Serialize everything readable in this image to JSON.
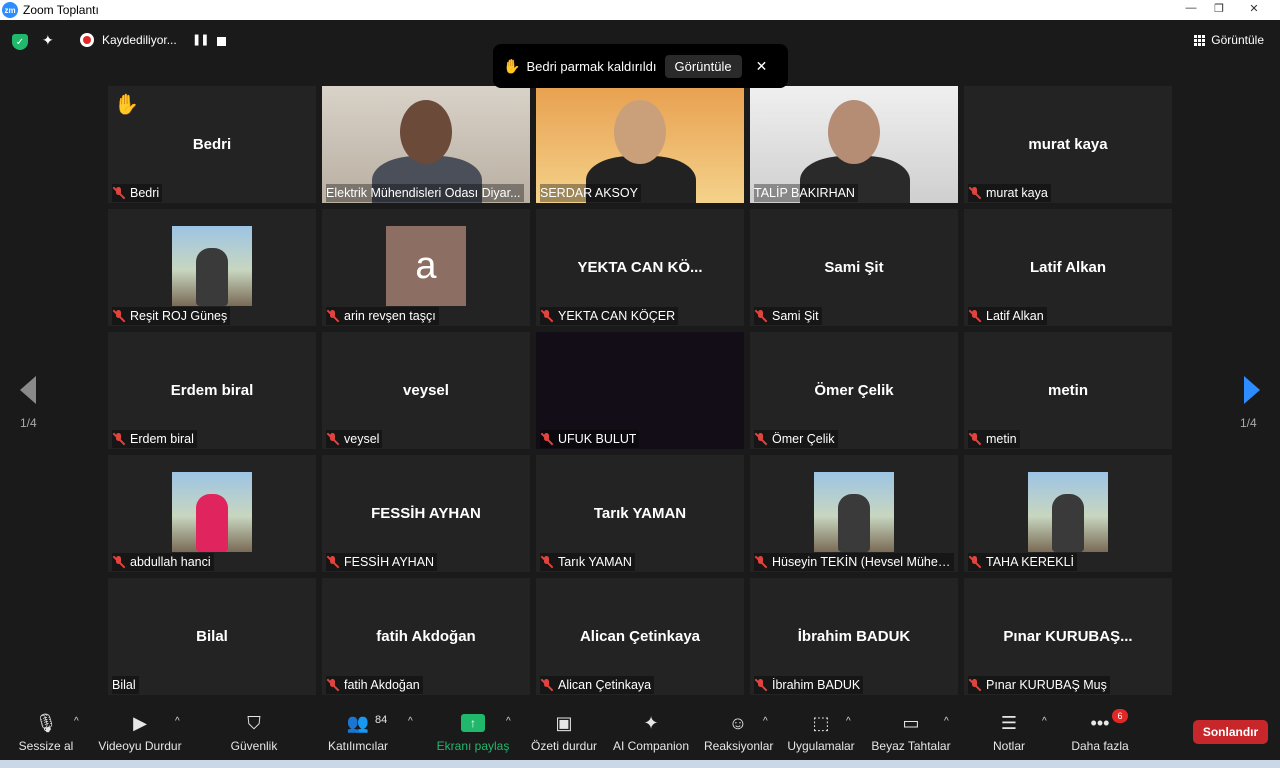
{
  "window": {
    "app_icon": "zm",
    "title": "Zoom Toplantı",
    "minimize": "—",
    "restore": "❐",
    "close": "✕"
  },
  "topbar": {
    "security_icon": "shield-check-icon",
    "ai_icon": "sparkle-icon",
    "recording_label": "Kaydediliyor...",
    "pause_symbol": "❚❚",
    "view_label": "Görüntüle"
  },
  "toast": {
    "hand": "✋",
    "message": "Bedri parmak kaldırıldı",
    "view_label": "Görüntüle",
    "close": "✕"
  },
  "pagination": {
    "left": "1/4",
    "right": "1/4"
  },
  "participants": [
    {
      "name": "Bedri",
      "center": "Bedri",
      "type": "name",
      "hand_raised": true,
      "muted": true
    },
    {
      "name": "Elektrik Mühendisleri Odası Diyar...",
      "type": "video",
      "muted": false
    },
    {
      "name": "SERDAR AKSOY",
      "type": "video",
      "muted": false,
      "active": true
    },
    {
      "name": "TALİP BAKIRHAN",
      "type": "video",
      "muted": false
    },
    {
      "name": "murat kaya",
      "center": "murat kaya",
      "type": "name",
      "muted": true
    },
    {
      "name": "Reşit ROJ Güneş",
      "type": "photo",
      "muted": true
    },
    {
      "name": "arin revşen taşçı",
      "type": "letter",
      "letter": "a",
      "muted": true
    },
    {
      "name": "YEKTA CAN KÖÇER",
      "center": "YEKTA CAN KÖ...",
      "type": "name",
      "muted": true
    },
    {
      "name": "Sami Şit",
      "center": "Sami Şit",
      "type": "name",
      "muted": true
    },
    {
      "name": "Latif Alkan",
      "center": "Latif Alkan",
      "type": "name",
      "muted": true
    },
    {
      "name": "Erdem biral",
      "center": "Erdem biral",
      "type": "name",
      "muted": true
    },
    {
      "name": "veysel",
      "center": "veysel",
      "type": "name",
      "muted": true
    },
    {
      "name": "UFUK BULUT",
      "type": "dark",
      "muted": true
    },
    {
      "name": "Ömer Çelik",
      "center": "Ömer Çelik",
      "type": "name",
      "muted": true
    },
    {
      "name": "metin",
      "center": "metin",
      "type": "name",
      "muted": true
    },
    {
      "name": "abdullah hanci",
      "type": "photo",
      "muted": true
    },
    {
      "name": "FESSİH AYHAN",
      "center": "FESSİH AYHAN",
      "type": "name",
      "muted": true
    },
    {
      "name": "Tarık YAMAN",
      "center": "Tarık YAMAN",
      "type": "name",
      "muted": true
    },
    {
      "name": "Hüseyin TEKİN (Hevsel Mühen...",
      "type": "photo",
      "muted": true
    },
    {
      "name": "TAHA KEREKLİ",
      "type": "photo",
      "muted": true
    },
    {
      "name": "Bilal",
      "center": "Bilal",
      "type": "name",
      "muted": false
    },
    {
      "name": "fatih Akdoğan",
      "center": "fatih Akdoğan",
      "type": "name",
      "muted": true
    },
    {
      "name": "Alican Çetinkaya",
      "center": "Alican Çetinkaya",
      "type": "name",
      "muted": true
    },
    {
      "name": "İbrahim BADUK",
      "center": "İbrahim BADUK",
      "type": "name",
      "muted": true
    },
    {
      "name": "Pınar KURUBAŞ Muş",
      "center": "Pınar KURUBAŞ...",
      "type": "name",
      "muted": true
    }
  ],
  "toolbar": {
    "mute": "Sessize al",
    "video": "Videoyu Durdur",
    "security": "Güvenlik",
    "participants": "Katılımcılar",
    "participants_count": "84",
    "share": "Ekranı paylaş",
    "summary": "Özeti durdur",
    "ai_companion": "AI Companion",
    "reactions": "Reaksiyonlar",
    "apps": "Uygulamalar",
    "whiteboards": "Beyaz Tahtalar",
    "notes": "Notlar",
    "more": "Daha fazla",
    "more_badge": "6",
    "end": "Sonlandır",
    "caret": "^"
  },
  "colors": {
    "accent": "#2d8cff",
    "share_green": "#20b86a",
    "end_red": "#c7272b",
    "active_border": "#ffe400",
    "muted_red": "#e0443e"
  }
}
